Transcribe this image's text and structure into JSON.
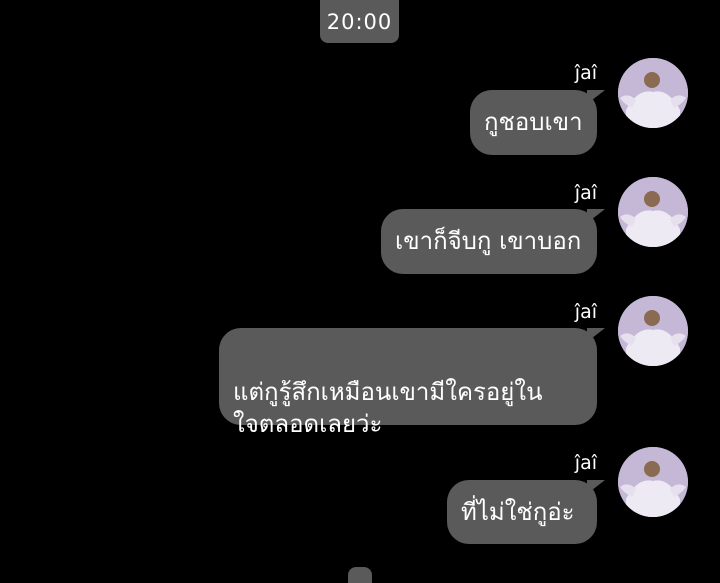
{
  "chat": {
    "time": "20:00",
    "messages": [
      {
        "sender": "ĵaî",
        "text": "กูชอบเขา"
      },
      {
        "sender": "ĵaî",
        "text": "เขาก็จีบกู เขาบอก"
      },
      {
        "sender": "ĵaî",
        "text": "แต่กูรู้สึกเหมือนเขามีใครอยู่ใน\nใจตลอดเลยว่ะ"
      },
      {
        "sender": "ĵaî",
        "text": "ที่ไม่ใช่กูอ่ะ"
      }
    ]
  },
  "colors": {
    "background": "#000000",
    "bubble": "#5a5a5a",
    "text": "#ffffff"
  },
  "icons": {
    "avatar": "profile-photo-avatar"
  }
}
